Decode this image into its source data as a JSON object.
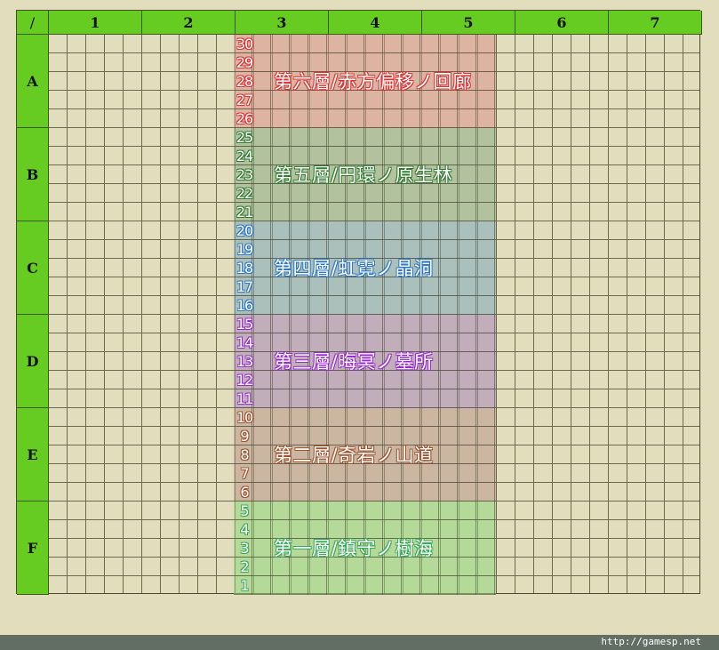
{
  "corner_label": "/",
  "columns": [
    "1",
    "2",
    "3",
    "4",
    "5",
    "6",
    "7"
  ],
  "rows": [
    "A",
    "B",
    "C",
    "D",
    "E",
    "F"
  ],
  "floor_bands": [
    {
      "title": "第六層/赤方偏移ノ回廊",
      "floors": [
        "30",
        "29",
        "28",
        "27",
        "26"
      ],
      "fill": "#d98f8a",
      "accent": "#dd3333"
    },
    {
      "title": "第五層/円環ノ原生林",
      "floors": [
        "25",
        "24",
        "23",
        "22",
        "21"
      ],
      "fill": "#8dab85",
      "accent": "#2f7a2f"
    },
    {
      "title": "第四層/虹霓ノ晶洞",
      "floors": [
        "20",
        "19",
        "18",
        "17",
        "16"
      ],
      "fill": "#7fa8ba",
      "accent": "#2f78c8"
    },
    {
      "title": "第三層/晦冥ノ墓所",
      "floors": [
        "15",
        "14",
        "13",
        "12",
        "11"
      ],
      "fill": "#a686b8",
      "accent": "#9a28d0"
    },
    {
      "title": "第二層/奇岩ノ山道",
      "floors": [
        "10",
        "9",
        "8",
        "7",
        "6"
      ],
      "fill": "#b8978b",
      "accent": "#a0522d"
    },
    {
      "title": "第一層/鎮守ノ樹海",
      "floors": [
        "5",
        "4",
        "3",
        "2",
        "1"
      ],
      "fill": "#8fd67a",
      "accent": "#3aaa5a"
    }
  ],
  "footer": {
    "credit": "http://gamesp.net"
  }
}
